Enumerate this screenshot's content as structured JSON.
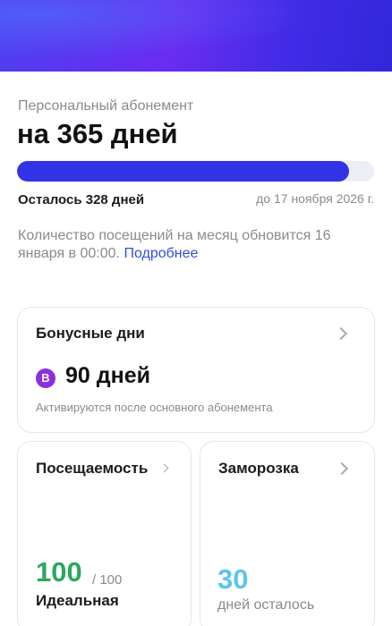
{
  "subscription": {
    "kicker": "Персональный абонемент",
    "title": "на 365 дней",
    "progress_fraction": 0.93,
    "remaining": "Осталось 328 дней",
    "until": "до 17 ноября 2026 г.",
    "info_text": "Количество посещений на месяц обновится 16 января в 00:00.",
    "info_link": "Подробнее",
    "colors": {
      "progress": "#3333e6",
      "link": "#2f4fd8"
    }
  },
  "bonus": {
    "title": "Бонусные дни",
    "badge": "B",
    "days": "90 дней",
    "note": "Активируются после основного абонемента",
    "badge_color": "#8b2fe0",
    "chevron_icon": "chevron-right-icon"
  },
  "attendance": {
    "title": "Посещаемость",
    "score": "100",
    "total": "/ 100",
    "label": "Идеальная",
    "score_color": "#2aa85c",
    "chevron_icon": "chevron-right-icon"
  },
  "freeze": {
    "title": "Заморозка",
    "number": "30",
    "label": "дней осталось",
    "number_color": "#5cc4ef",
    "chevron_icon": "chevron-right-icon"
  }
}
